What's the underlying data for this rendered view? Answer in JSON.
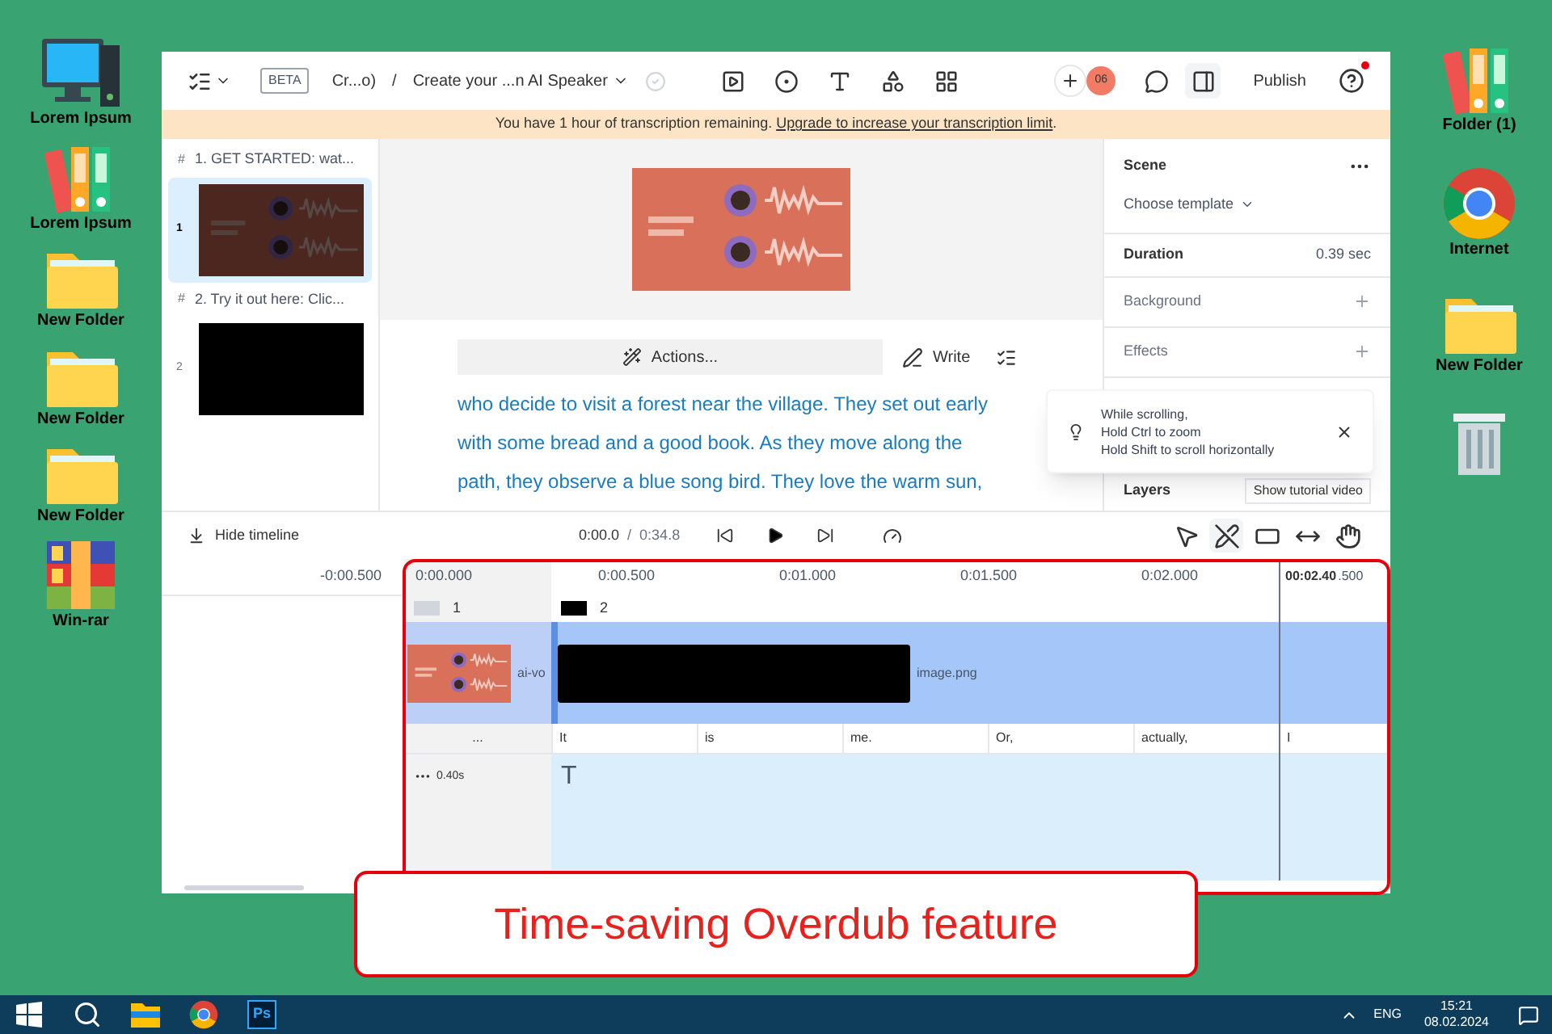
{
  "desktop_left": [
    {
      "label": "Lorem Ipsum",
      "kind": "computer"
    },
    {
      "label": "Lorem Ipsum",
      "kind": "binders"
    },
    {
      "label": "New Folder",
      "kind": "folder"
    },
    {
      "label": "New Folder",
      "kind": "folder"
    },
    {
      "label": "New Folder",
      "kind": "folder"
    },
    {
      "label": "Win-rar",
      "kind": "archive"
    }
  ],
  "desktop_right": [
    {
      "label": "Folder (1)",
      "kind": "binders"
    },
    {
      "label": "Internet",
      "kind": "browser"
    },
    {
      "label": "New Folder",
      "kind": "folder"
    },
    {
      "kind": "bin"
    }
  ],
  "app": {
    "toolbar": {
      "beta": "BETA",
      "breadcrumb": "Cr...o)",
      "separator": "/",
      "project": "Create your ...n AI Speaker",
      "avatar": "06",
      "publish": "Publish",
      "panel_selected": true,
      "help_badge": true
    },
    "banner": {
      "text": "You have 1 hour of transcription remaining. ",
      "link": "Upgrade to increase your transcription limit",
      "end": "."
    },
    "scenes": [
      {
        "marker": "#",
        "title": "1. GET STARTED: wat...",
        "number": "1",
        "selected": true,
        "kind": "picture"
      },
      {
        "marker": "#",
        "title": "2. Try it out here: Clic...",
        "number": "2",
        "selected": false,
        "kind": "blank"
      }
    ],
    "editor": {
      "actions": "Actions...",
      "write": "Write",
      "lines": [
        "who decide to visit a forest near the village.  They set out early",
        "with some bread and a good book. As they move along the",
        "path, they observe a blue song bird. They love the warm sun,"
      ]
    },
    "inspector": {
      "scene": "Scene",
      "template": "Choose template",
      "duration_label": "Duration",
      "duration": "0.39 sec",
      "sections": [
        "Background",
        "Effects"
      ],
      "layers": "Layers",
      "tutorial": "Show tutorial video"
    },
    "tip": {
      "lines": [
        "While scrolling,",
        "Hold Ctrl to zoom",
        "Hold Shift to scroll horizontally"
      ]
    },
    "timeline": {
      "hide": "Hide timeline",
      "current": "0:00.0",
      "separator": "/",
      "total": "0:34.8",
      "tools": [
        {
          "kind": "pointer",
          "selected": false
        },
        {
          "kind": "pen",
          "selected": true
        },
        {
          "kind": "clip",
          "selected": false
        },
        {
          "kind": "stretch",
          "selected": false
        },
        {
          "kind": "hand",
          "selected": false
        }
      ],
      "ruler_left": "-0:00.500",
      "ruler_start": "0:00.000",
      "ruler": [
        "0:00.500",
        "0:01.000",
        "0:01.500",
        "0:02.000"
      ],
      "playhead": "00:02.40",
      "ruler_end": ".500",
      "scene_marks": [
        {
          "number": "1",
          "kind": "picture"
        },
        {
          "number": "2",
          "kind": "blank"
        }
      ],
      "clips": [
        "ai-vo",
        "image.png"
      ],
      "words_label": "...",
      "words": [
        "It",
        "is",
        "me.",
        "Or,",
        "actually,",
        "I"
      ],
      "track_label": "0.40s",
      "track_icon": "T"
    }
  },
  "callout": "Time-saving Overdub feature",
  "taskbar": {
    "apps": [
      {
        "kind": "start"
      },
      {
        "kind": "search"
      },
      {
        "kind": "explorer"
      },
      {
        "kind": "browser"
      },
      {
        "kind": "photoshop",
        "label": "Ps"
      }
    ],
    "language": "ENG",
    "time": "15:21",
    "date": "08.02.2024"
  }
}
